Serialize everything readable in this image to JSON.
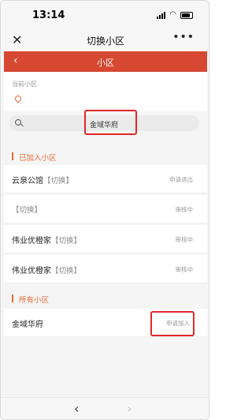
{
  "status_bar": {
    "time": "13:14"
  },
  "nav": {
    "close_icon": "✕",
    "title": "切换小区",
    "more_icon": "•••"
  },
  "header": {
    "back_icon": "‹",
    "title": "小区"
  },
  "current": {
    "label": "当前小区"
  },
  "search": {
    "value": "金域华府"
  },
  "joined": {
    "title": "已加入小区",
    "items": [
      {
        "name": "云泉公馆",
        "switch": "【切换】",
        "status": "申请退出"
      },
      {
        "name": "",
        "switch": "【切换】",
        "status": "审核中"
      },
      {
        "name": "伟业优橙家",
        "switch": "【切换】",
        "status": "审核中"
      },
      {
        "name": "伟业优橙家",
        "switch": "【切换】",
        "status": "审核中"
      }
    ]
  },
  "all": {
    "title": "所有小区",
    "items": [
      {
        "name": "金域华府",
        "action": "申请加入"
      }
    ]
  },
  "toolbar": {
    "back_icon": "‹",
    "forward_icon": "›"
  },
  "colors": {
    "accent": "#d64832",
    "section_orange": "#e46a35",
    "annotation_red": "#e3262a"
  }
}
